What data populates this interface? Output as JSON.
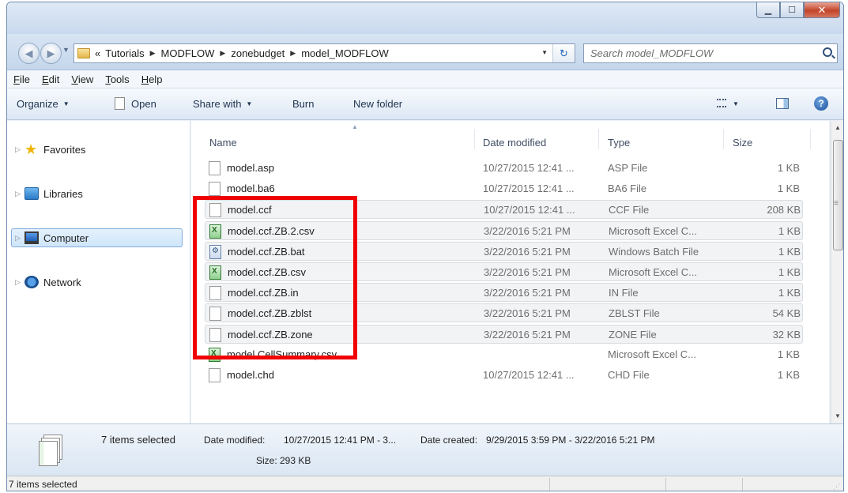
{
  "address": {
    "overflow": "«",
    "crumbs": [
      "Tutorials",
      "MODFLOW",
      "zonebudget",
      "model_MODFLOW"
    ]
  },
  "search": {
    "placeholder": "Search model_MODFLOW"
  },
  "menu": {
    "file": {
      "u": "F",
      "rest": "ile"
    },
    "edit": {
      "u": "E",
      "rest": "dit"
    },
    "view": {
      "u": "V",
      "rest": "iew"
    },
    "tools": {
      "u": "T",
      "rest": "ools"
    },
    "help": {
      "u": "H",
      "rest": "elp"
    }
  },
  "toolbar": {
    "organize": "Organize",
    "open": "Open",
    "share_with": "Share with",
    "burn": "Burn",
    "new_folder": "New folder"
  },
  "nav": {
    "favorites": "Favorites",
    "libraries": "Libraries",
    "computer": "Computer",
    "network": "Network"
  },
  "columns": {
    "name": "Name",
    "date": "Date modified",
    "type": "Type",
    "size": "Size"
  },
  "files": [
    {
      "name": "model.asp",
      "date": "10/27/2015 12:41 ...",
      "type": "ASP File",
      "size": "1 KB",
      "icon": "file-icon",
      "selected": false
    },
    {
      "name": "model.ba6",
      "date": "10/27/2015 12:41 ...",
      "type": "BA6 File",
      "size": "1 KB",
      "icon": "file-icon",
      "selected": false
    },
    {
      "name": "model.ccf",
      "date": "10/27/2015 12:41 ...",
      "type": "CCF File",
      "size": "208 KB",
      "icon": "file-icon",
      "selected": true
    },
    {
      "name": "model.ccf.ZB.2.csv",
      "date": "3/22/2016 5:21 PM",
      "type": "Microsoft Excel C...",
      "size": "1 KB",
      "icon": "excel-csv-icon",
      "selected": true
    },
    {
      "name": "model.ccf.ZB.bat",
      "date": "3/22/2016 5:21 PM",
      "type": "Windows Batch File",
      "size": "1 KB",
      "icon": "batch-file-icon",
      "selected": true
    },
    {
      "name": "model.ccf.ZB.csv",
      "date": "3/22/2016 5:21 PM",
      "type": "Microsoft Excel C...",
      "size": "1 KB",
      "icon": "excel-csv-icon",
      "selected": true
    },
    {
      "name": "model.ccf.ZB.in",
      "date": "3/22/2016 5:21 PM",
      "type": "IN File",
      "size": "1 KB",
      "icon": "file-icon",
      "selected": true
    },
    {
      "name": "model.ccf.ZB.zblst",
      "date": "3/22/2016 5:21 PM",
      "type": "ZBLST File",
      "size": "54 KB",
      "icon": "file-icon",
      "selected": true
    },
    {
      "name": "model.ccf.ZB.zone",
      "date": "3/22/2016 5:21 PM",
      "type": "ZONE File",
      "size": "32 KB",
      "icon": "file-icon",
      "selected": true
    },
    {
      "name": "model.CellSummary.csv",
      "date": "",
      "type": "Microsoft Excel C...",
      "size": "1 KB",
      "icon": "excel-csv-icon",
      "selected": false
    },
    {
      "name": "model.chd",
      "date": "10/27/2015 12:41 ...",
      "type": "CHD File",
      "size": "1 KB",
      "icon": "file-icon",
      "selected": false
    }
  ],
  "details": {
    "count": "7 items selected",
    "date_modified_label": "Date modified:",
    "date_modified_value": "10/27/2015 12:41 PM - 3...",
    "date_created_label": "Date created:",
    "date_created_value": "9/29/2015 3:59 PM - 3/22/2016 5:21 PM",
    "size_label": "Size:",
    "size_value": "293 KB"
  },
  "status": {
    "text": "7 items selected"
  },
  "colors": {
    "highlight_box": "#f00000",
    "selection_bg": "#f1f3f5",
    "close_button": "#c2442a"
  }
}
